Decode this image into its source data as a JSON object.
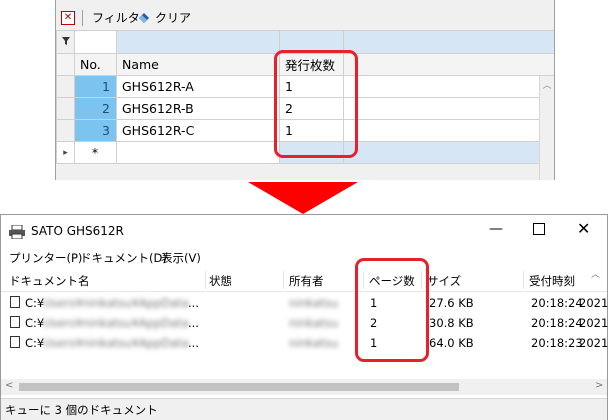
{
  "grid": {
    "toolbar": {
      "filter_label": "フィルタ",
      "clear_label": "クリア"
    },
    "columns": [
      "No.",
      "Name",
      "発行枚数"
    ],
    "rows": [
      {
        "no": "1",
        "name": "GHS612R-A",
        "count": "1"
      },
      {
        "no": "2",
        "name": "GHS612R-B",
        "count": "2"
      },
      {
        "no": "3",
        "name": "GHS612R-C",
        "count": "1"
      }
    ],
    "new_row_marker": "*"
  },
  "queue_window": {
    "title": "SATO GHS612R",
    "menu": [
      "プリンター(P)",
      "ドキュメント(D)",
      "表示(V)"
    ],
    "columns": [
      "ドキュメント名",
      "状態",
      "所有者",
      "ページ数",
      "サイズ",
      "受付時刻"
    ],
    "rows": [
      {
        "doc": "C:¥",
        "doc_rest": "Users¥ninkatsu¥AppData¥Local¥Temp¥label",
        "owner": "ninkatsu",
        "pages": "1",
        "size": "27.6 KB",
        "time": "20:18:24",
        "date": "2021/"
      },
      {
        "doc": "C:¥",
        "doc_rest": "Users¥ninkatsu¥AppData¥Local¥Temp¥label",
        "owner": "ninkatsu",
        "pages": "2",
        "size": "30.8 KB",
        "time": "20:18:24",
        "date": "2021/"
      },
      {
        "doc": "C:¥",
        "doc_rest": "Users¥ninkatsu¥AppData¥Local¥Temp¥label",
        "owner": "ninkatsu",
        "pages": "1",
        "size": "64.0 KB",
        "time": "20:18:23",
        "date": "2021/"
      }
    ],
    "ellipsis": "...",
    "status": "キューに 3 個のドキュメント"
  },
  "colors": {
    "highlight": "#e8202a",
    "arrow": "#ff0000",
    "filter_row": "#d6e6f5",
    "selected_no": "#7cc3ef"
  }
}
